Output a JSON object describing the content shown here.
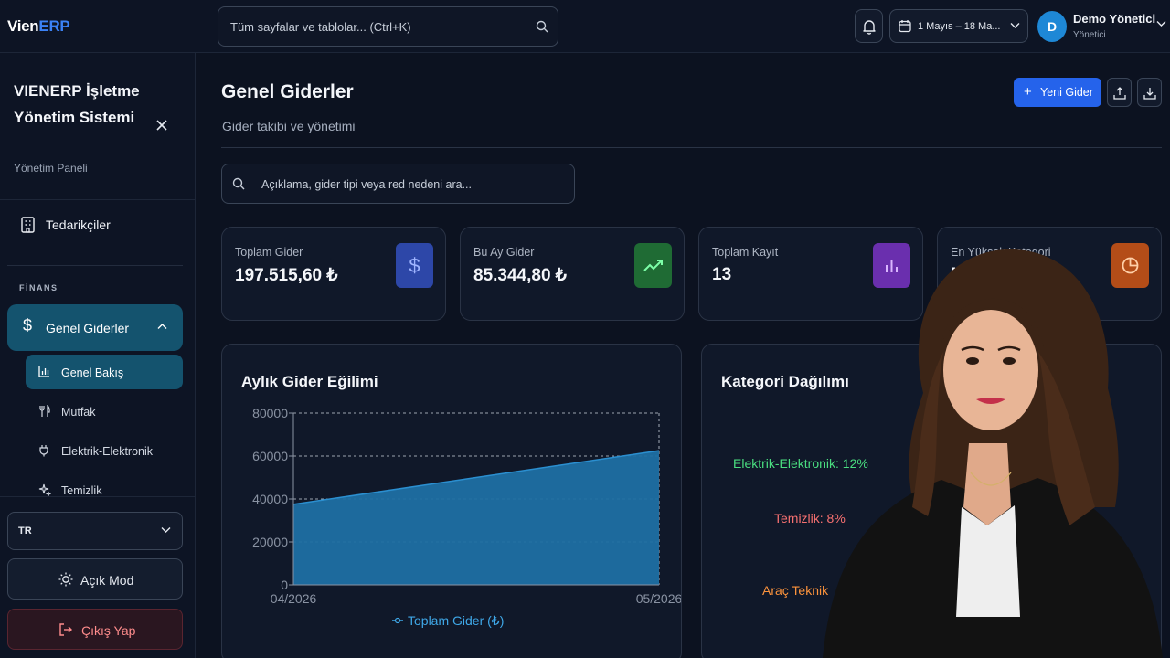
{
  "app": {
    "brand_part1": "Vien",
    "brand_part2": "ERP"
  },
  "header": {
    "search_placeholder": "Tüm sayfalar ve tablolar... (Ctrl+K)",
    "date_range": "1 Mayıs – 18 Ma...",
    "user_initial": "D",
    "user_name": "Demo Yönetici",
    "user_role": "Yönetici"
  },
  "sidebar": {
    "title": "VIENERP İşletme Yönetim Sistemi",
    "subtitle": "Yönetim Paneli",
    "top_item": "Tedarikçiler",
    "section": "FİNANS",
    "active_group": "Genel Giderler",
    "sub_items": [
      "Genel Bakış",
      "Mutfak",
      "Elektrik-Elektronik",
      "Temizlik"
    ],
    "language": "TR",
    "light_mode": "Açık Mod",
    "logout": "Çıkış Yap"
  },
  "main": {
    "title": "Genel Giderler",
    "subtitle": "Gider takibi ve yönetimi",
    "new_button": "Yeni Gider",
    "search_placeholder": "Açıklama, gider tipi veya red nedeni ara..."
  },
  "cards": [
    {
      "label": "Toplam Gider",
      "value": "197.515,60 ₺",
      "icon": "dollar-icon",
      "color": "#3b5bdb"
    },
    {
      "label": "Bu Ay Gider",
      "value": "85.344,80 ₺",
      "icon": "trending-up-icon",
      "color": "#1f7a3a"
    },
    {
      "label": "Toplam Kayıt",
      "value": "13",
      "icon": "bar-chart-icon",
      "color": "#7b3bc4"
    },
    {
      "label": "En Yüksek Kategori",
      "value": "M",
      "icon": "pie-chart-icon",
      "color": "#c2571b"
    }
  ],
  "monthly_panel": {
    "title": "Aylık Gider Eğilimi"
  },
  "category_panel": {
    "title": "Kategori Dağılımı",
    "labels": [
      {
        "text": "Elektrik-Elektronik: 12%",
        "color": "#4ade80"
      },
      {
        "text": "Temizlik: 8%",
        "color": "#f87171"
      },
      {
        "text": "Araç Teknik",
        "color": "#fb923c"
      }
    ]
  },
  "chart_data": {
    "type": "area",
    "title": "Aylık Gider Eğilimi",
    "x": [
      "04/2026",
      "05/2026"
    ],
    "series": [
      {
        "name": "Toplam Gider (₺)",
        "values": [
          37500,
          62500
        ],
        "color": "#1f6fa3"
      }
    ],
    "y_ticks": [
      0,
      20000,
      40000,
      60000,
      80000
    ],
    "ylim": [
      0,
      80000
    ],
    "grid": true,
    "legend": "bottom"
  }
}
